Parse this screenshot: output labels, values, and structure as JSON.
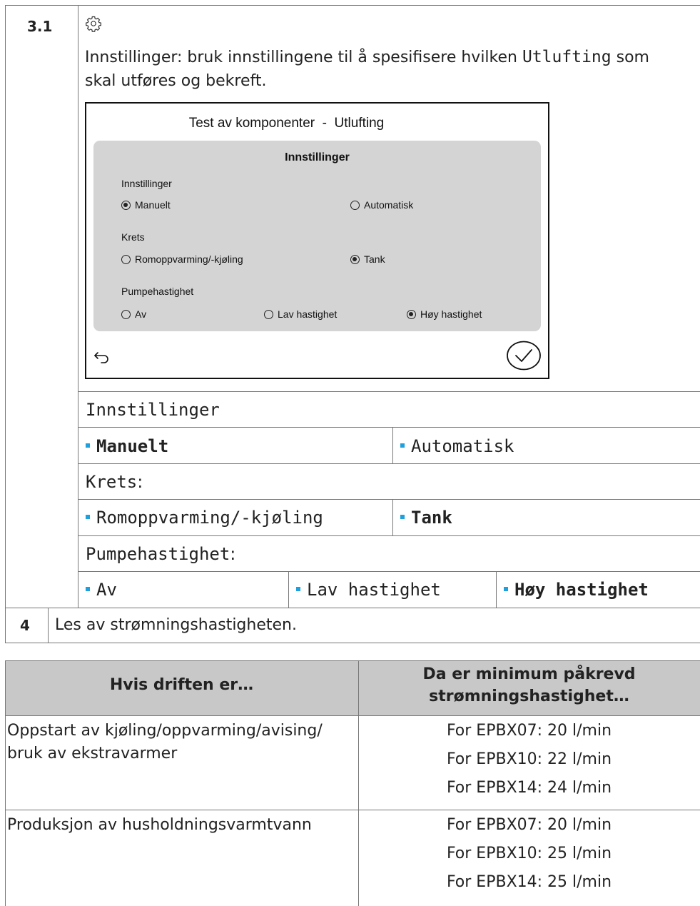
{
  "step31": {
    "number": "3.1",
    "icon": "gear-icon",
    "intro_part1": "Innstillinger: bruk innstillingene til å spesifisere hvilken ",
    "intro_code": "Utlufting",
    "intro_part2": " som",
    "intro_line2": "skal utføres og bekreft."
  },
  "dialog": {
    "title": "Test av komponenter  -  Utlufting",
    "panel_title": "Innstillinger",
    "group1_label": "Innstillinger",
    "g1_opt1": "Manuelt",
    "g1_opt2": "Automatisk",
    "g1_selected": "Manuelt",
    "group2_label": "Krets",
    "g2_opt1": "Romoppvarming/-kjøling",
    "g2_opt2": "Tank",
    "g2_selected": "Tank",
    "group3_label": "Pumpehastighet",
    "g3_opt1": "Av",
    "g3_opt2": "Lav hastighet",
    "g3_opt3": "Høy hastighet",
    "g3_selected": "Høy hastighet",
    "back_icon": "back-arrow-icon",
    "confirm_icon": "checkmark-circle-icon"
  },
  "options_table": {
    "row1_label": "Innstillinger",
    "row1_opt1": "Manuelt",
    "row1_opt2": "Automatisk",
    "row2_label": "Krets",
    "row2_colon": ":",
    "row2_opt1": "Romoppvarming/-kjøling",
    "row2_opt2": "Tank",
    "row3_label": "Pumpehastighet",
    "row3_colon": ":",
    "row3_opt1": "Av",
    "row3_opt2": "Lav hastighet",
    "row3_opt3": "Høy hastighet",
    "bullet_color": "#1ea0dc"
  },
  "step4": {
    "number": "4",
    "text": "Les av strømningshastigheten."
  },
  "flow_table": {
    "header_col1": "Hvis driften er…",
    "header_col2_line1": "Da er minimum påkrevd",
    "header_col2_line2": "strømningshastighet…",
    "row1_col1_line1": "Oppstart av kjøling/oppvarming/avising/",
    "row1_col1_line2": "bruk av ekstravarmer",
    "row1_v1": "For EPBX07: 20 l/min",
    "row1_v2": "For EPBX10: 22 l/min",
    "row1_v3": "For EPBX14: 24 l/min",
    "row2_col1": "Produksjon av husholdningsvarmtvann",
    "row2_v1": "For EPBX07: 20 l/min",
    "row2_v2": "For EPBX10: 25 l/min",
    "row2_v3": "For EPBX14: 25 l/min",
    "header_bg": "#c8c8c8"
  }
}
